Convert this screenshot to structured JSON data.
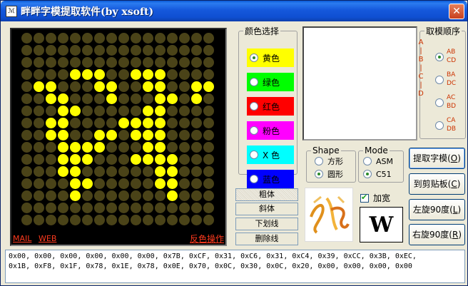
{
  "window": {
    "title": "畔畔字模提取软件(by xsoft)",
    "close_label": "✕"
  },
  "led_matrix": {
    "rows": 16,
    "cols": 16,
    "lit": [
      "0000000000000000",
      "0000000000000000",
      "0000000000000000",
      "0000111001110000",
      "0110001100110011",
      "0011000100011010",
      "0001100000110000",
      "0011000011110000",
      "0011001101110000",
      "0001111000110000",
      "0001110001111000",
      "0001100000011000",
      "0000110000011000",
      "0000100000001000",
      "0000000000000000",
      "0000000000000000"
    ],
    "on_color": "#ffff00",
    "off_color": "#4a4318"
  },
  "links": {
    "mail": "MAIL",
    "web": "WEB",
    "invert": "反色操作"
  },
  "color_group": {
    "legend": "颜色选择",
    "options": [
      {
        "label": "黄色",
        "color": "#ffff00",
        "checked": true
      },
      {
        "label": "绿色",
        "color": "#00ff00",
        "checked": false
      },
      {
        "label": "红色",
        "color": "#ff0000",
        "checked": false
      },
      {
        "label": "粉色",
        "color": "#ff00ff",
        "checked": false
      },
      {
        "label": "X 色",
        "color": "#00ffff",
        "checked": false
      },
      {
        "label": "蓝色",
        "color": "#0000ff",
        "checked": false
      }
    ]
  },
  "order_group": {
    "legend": "取模顺序",
    "vertical_label": "A|B|C|D",
    "options": [
      {
        "line1": "AB",
        "line2": "CD",
        "checked": true
      },
      {
        "line1": "BA",
        "line2": "DC",
        "checked": false
      },
      {
        "line1": "AC",
        "line2": "BD",
        "checked": false
      },
      {
        "line1": "CA",
        "line2": "DB",
        "checked": false
      }
    ]
  },
  "shape_group": {
    "legend": "Shape",
    "options": [
      {
        "label": "方形",
        "checked": false
      },
      {
        "label": "圆形",
        "checked": true
      }
    ]
  },
  "mode_group": {
    "legend": "Mode",
    "options": [
      {
        "label": "ASM",
        "checked": false
      },
      {
        "label": "C51",
        "checked": true
      }
    ]
  },
  "style_buttons": [
    {
      "label": "粗体",
      "pressed": true
    },
    {
      "label": "斜体",
      "pressed": false
    },
    {
      "label": "下划线",
      "pressed": false
    },
    {
      "label": "删除线",
      "pressed": false
    }
  ],
  "widen": {
    "label": "加宽",
    "checked": true
  },
  "glyph_preview": "W",
  "actions": {
    "extract": {
      "label": "提取字模",
      "key": "O"
    },
    "clipboard": {
      "label": "到剪贴板",
      "key": "C"
    },
    "rotate_left": {
      "label": "左旋90度",
      "key": "L"
    },
    "rotate_right": {
      "label": "右旋90度",
      "key": "R"
    }
  },
  "output": {
    "line1": "0x00, 0x00, 0x00, 0x00, 0x00, 0x00, 0x7B, 0xCF, 0x31, 0xC6, 0x31, 0xC4, 0x39, 0xCC, 0x3B, 0xEC,",
    "line2": "0x1B, 0xF8, 0x1F, 0x78, 0x1E, 0x78, 0x0E, 0x70, 0x0C, 0x30, 0x0C, 0x20, 0x00, 0x00, 0x00, 0x00"
  }
}
